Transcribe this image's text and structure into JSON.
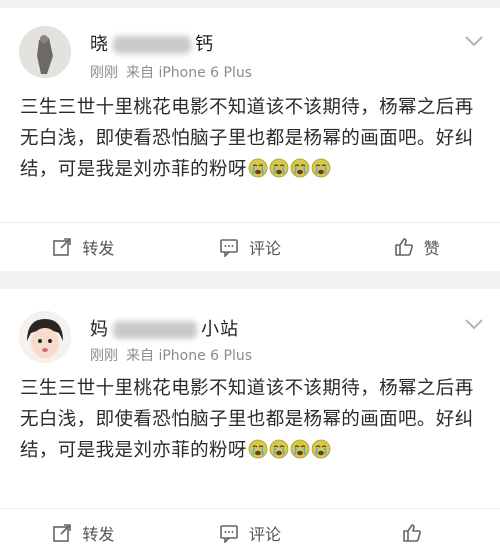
{
  "posts": [
    {
      "username_visible_start": "晓",
      "username_visible_end": "钙",
      "time": "刚刚",
      "source": "来自 iPhone 6 Plus",
      "content": "三生三世十里桃花电影不知道该不该期待，杨幂之后再无白浅，即使看恐怕脑子里也都是杨幂的画面吧。好纠结，可是我是刘亦菲的粉呀",
      "emoji_icon": "crying-face-icon",
      "emoji_count": 4,
      "actions": {
        "repost": "转发",
        "comment": "评论",
        "like": "赞"
      }
    },
    {
      "username_visible_start": "妈",
      "username_visible_end": "小站",
      "time": "刚刚",
      "source": "来自 iPhone 6 Plus",
      "content": "三生三世十里桃花电影不知道该不该期待，杨幂之后再无白浅，即使看恐怕脑子里也都是杨幂的画面吧。好纠结，可是我是刘亦菲的粉呀",
      "emoji_icon": "crying-face-icon",
      "emoji_count": 4,
      "actions": {
        "repost": "转发",
        "comment": "评论",
        "like": ""
      }
    }
  ],
  "colors": {
    "background": "#f2f2f2",
    "card": "#ffffff",
    "meta_text": "#8c8c8c",
    "emoji_face": "#d6c84a"
  }
}
